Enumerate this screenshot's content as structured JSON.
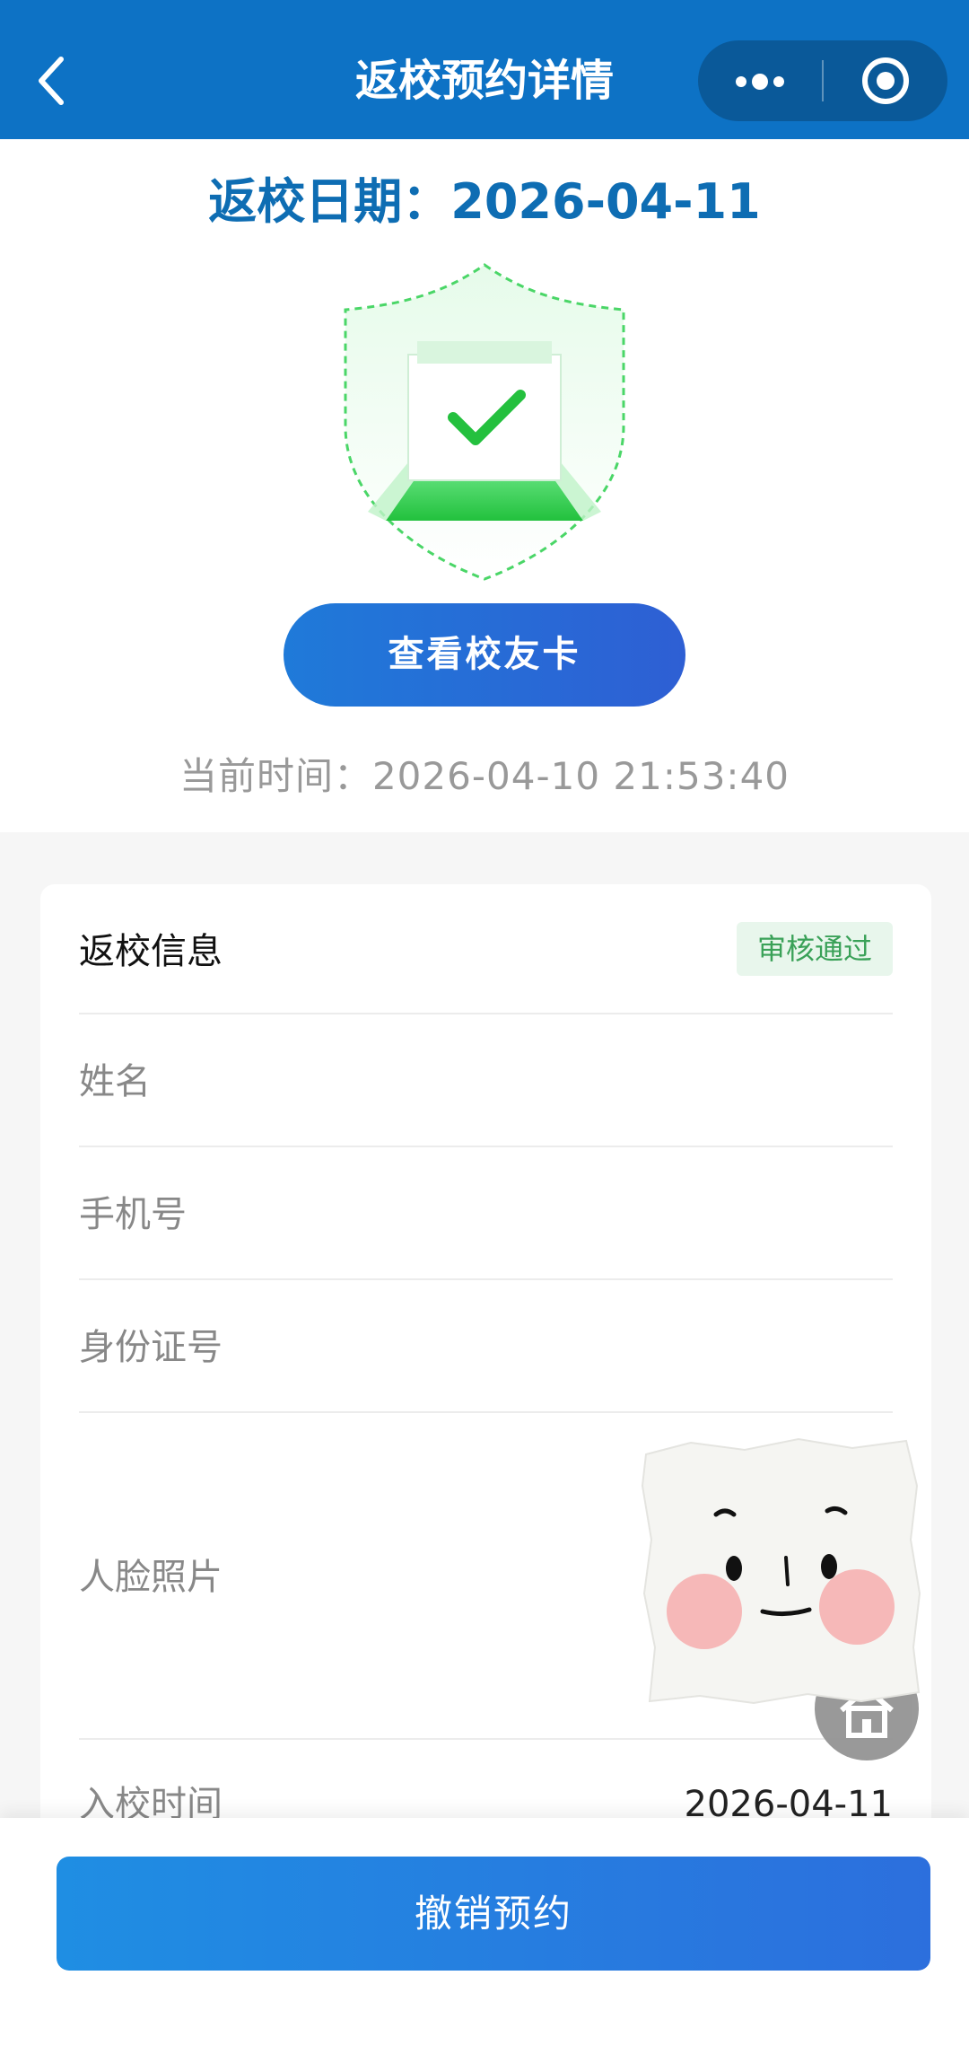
{
  "header": {
    "title": "返校预约详情",
    "back_icon": "chevron-left-icon",
    "more_icon": "more-dots-icon",
    "close_icon": "target-circle-icon"
  },
  "top": {
    "date_label": "返校日期：2026-04-11",
    "shield_icon": "shield-check-icon",
    "view_card_button": "查看校友卡",
    "current_time": "当前时间：2026-04-10 21:53:40"
  },
  "card": {
    "title": "返校信息",
    "status_badge": "审核通过",
    "rows": [
      {
        "label": "姓名",
        "value": ""
      },
      {
        "label": "手机号",
        "value": ""
      },
      {
        "label": "身份证号",
        "value": ""
      },
      {
        "label": "人脸照片",
        "value": ""
      },
      {
        "label": "入校时间",
        "value": "2026-04-11"
      }
    ]
  },
  "bottom": {
    "cancel_button": "撤销预约"
  },
  "colors": {
    "header_bg": "#0d72c5",
    "title_blue": "#0e6db3",
    "badge_green": "#3aa158",
    "shield_green": "#2ecc40"
  }
}
